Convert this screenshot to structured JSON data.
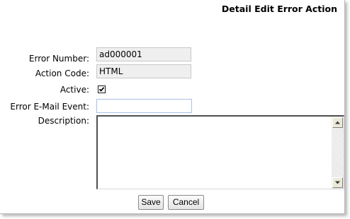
{
  "page": {
    "title": "Detail Edit Error Action"
  },
  "form": {
    "error_number": {
      "label": "Error Number:",
      "value": "ad000001"
    },
    "action_code": {
      "label": "Action Code:",
      "value": "HTML"
    },
    "active": {
      "label": "Active:",
      "checked": true
    },
    "error_email_event": {
      "label": "Error E-Mail Event:",
      "value": ""
    },
    "description": {
      "label": "Description:",
      "value": ""
    }
  },
  "buttons": {
    "save": "Save",
    "cancel": "Cancel"
  },
  "icons": {
    "checkbox_check": "check-icon",
    "scroll_up": "triangle-up-icon",
    "scroll_down": "triangle-down-icon"
  }
}
